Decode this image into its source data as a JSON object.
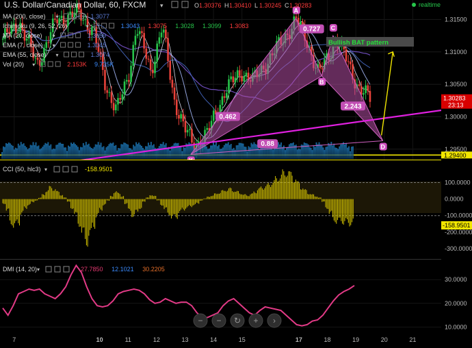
{
  "header": {
    "title": "U.S. Dollar/Canadian Dollar, 60, FXCM",
    "ohlc": [
      {
        "k": "O",
        "v": "1.30376"
      },
      {
        "k": "H",
        "v": "1.30410"
      },
      {
        "k": "L",
        "v": "1.30245"
      },
      {
        "k": "C",
        "v": "1.30283"
      }
    ],
    "realtime": "realtime",
    "colors": {
      "ohlc_value": "#ff3b3b",
      "realtime_dot": "#26c64a"
    }
  },
  "indicators": [
    {
      "name": "MA (200, close)",
      "values": [
        {
          "v": "1.3077",
          "color": "#5b7bd5"
        }
      ]
    },
    {
      "name": "Ichimoku (9, 26, 52, 26)",
      "values": [
        {
          "v": "1.3043",
          "color": "#3b8cff"
        },
        {
          "v": "1.3075",
          "color": "#ff3b3b"
        },
        {
          "v": "1.3028",
          "color": "#27c44a"
        },
        {
          "v": "1.3099",
          "color": "#27c44a"
        },
        {
          "v": "1.3083",
          "color": "#ff3b3b"
        }
      ]
    },
    {
      "name": "MA (20, close)",
      "values": [
        {
          "v": "1.3059",
          "color": "#5b7bd5"
        }
      ]
    },
    {
      "name": "EMA (7, close)",
      "values": [
        {
          "v": "1.3045",
          "color": "#5b7bd5"
        }
      ]
    },
    {
      "name": "EMA (55, close)",
      "values": [
        {
          "v": "1.3074",
          "color": "#5b7bd5"
        }
      ]
    },
    {
      "name": "Vol (20)",
      "values": [
        {
          "v": "2.153K",
          "color": "#ff3b3b"
        },
        {
          "v": "9.735K",
          "color": "#3b8cff"
        }
      ]
    }
  ],
  "chart_data": [
    {
      "type": "line",
      "name": "USD/CAD 60-minute price",
      "x_ticks": [
        "7",
        "10",
        "11",
        "12",
        "13",
        "14",
        "15",
        "17",
        "18",
        "19",
        "20",
        "21"
      ],
      "y_ticks": [
        1.295,
        1.3,
        1.305,
        1.31,
        1.315
      ],
      "ylim": [
        1.2935,
        1.318
      ],
      "current_price": "1.30283",
      "current_countdown": "23:13",
      "support_label": "1.29400",
      "pattern": {
        "label": "Bullish BAT pattern",
        "points": [
          {
            "name": "X",
            "x": 13.2,
            "y": 1.2942
          },
          {
            "name": "A",
            "x": 16.9,
            "y": 1.3152
          },
          {
            "name": "B",
            "x": 17.8,
            "y": 1.3063
          },
          {
            "name": "C",
            "x": 18.2,
            "y": 1.3125
          },
          {
            "name": "D",
            "x": 19.95,
            "y": 1.2963
          }
        ],
        "ratios": [
          {
            "label": "0.462",
            "x": 14.5,
            "y": 1.3
          },
          {
            "label": "0.727",
            "x": 17.45,
            "y": 1.3135
          },
          {
            "label": "2.243",
            "x": 18.9,
            "y": 1.3016
          },
          {
            "label": "0.88",
            "x": 15.9,
            "y": 1.2958
          }
        ]
      }
    },
    {
      "type": "bar",
      "name": "CCI (50, hlc3)",
      "label_value": "-158.9501",
      "y_ticks": [
        100,
        0,
        -100,
        -200,
        -300
      ],
      "ylim": [
        -350,
        210
      ],
      "values": [
        -30,
        -80,
        -160,
        -190,
        -160,
        -100,
        -60,
        -40,
        -20,
        -10,
        10,
        30,
        60,
        80,
        70,
        50,
        30,
        10,
        -20,
        -60,
        -110,
        -170,
        -240,
        -290,
        -250,
        -180,
        -120,
        -70,
        -40,
        -10,
        20,
        50,
        40,
        20,
        -30,
        -80,
        -110,
        -90,
        -60,
        -20,
        10,
        30,
        20,
        -10,
        -40,
        -70,
        -100,
        -130,
        -120,
        -90,
        -70,
        -60,
        -50,
        -40,
        -30,
        -10,
        5,
        15,
        25,
        35,
        45,
        55,
        65,
        70,
        60,
        50,
        40,
        30,
        25,
        35,
        50,
        70,
        80,
        90,
        100,
        120,
        140,
        160,
        180,
        190,
        170,
        140,
        110,
        80,
        60,
        40,
        30,
        20,
        10,
        -20,
        -60,
        -100,
        -140,
        -160,
        -150,
        -160,
        -170,
        -160
      ]
    },
    {
      "type": "line",
      "name": "DMI (14, 20)",
      "label_values": [
        {
          "v": "27.7850",
          "color": "#e53a72"
        },
        {
          "v": "12.1021",
          "color": "#3b8cff"
        },
        {
          "v": "30.2205",
          "color": "#e8702a"
        }
      ],
      "y_ticks": [
        30,
        20,
        10
      ],
      "ylim": [
        7.5,
        37
      ],
      "values": [
        18,
        15,
        19,
        24,
        25,
        26,
        25.5,
        26,
        24,
        23,
        22,
        24,
        27,
        32,
        36,
        33,
        27,
        22,
        19,
        18.5,
        19,
        21,
        24,
        25,
        25.5,
        26,
        25.5,
        24,
        21.5,
        20,
        20.5,
        22,
        21,
        20,
        20.5,
        20.5,
        19,
        16,
        14,
        14,
        15,
        16,
        19,
        21,
        22,
        20,
        18,
        16,
        15,
        17,
        18.5,
        18,
        17.5,
        17,
        15,
        13,
        11,
        10.5,
        11,
        12.5,
        13,
        15,
        18,
        21,
        23.5,
        25,
        26,
        27.5
      ]
    }
  ],
  "controls": [
    "zoom-out",
    "zoom-out-alt",
    "reset",
    "zoom-in",
    "scroll-right"
  ],
  "controls_glyphs": {
    "zoom-out": "−",
    "zoom-out-alt": "−",
    "reset": "↻",
    "zoom-in": "+",
    "scroll-right": "›"
  }
}
